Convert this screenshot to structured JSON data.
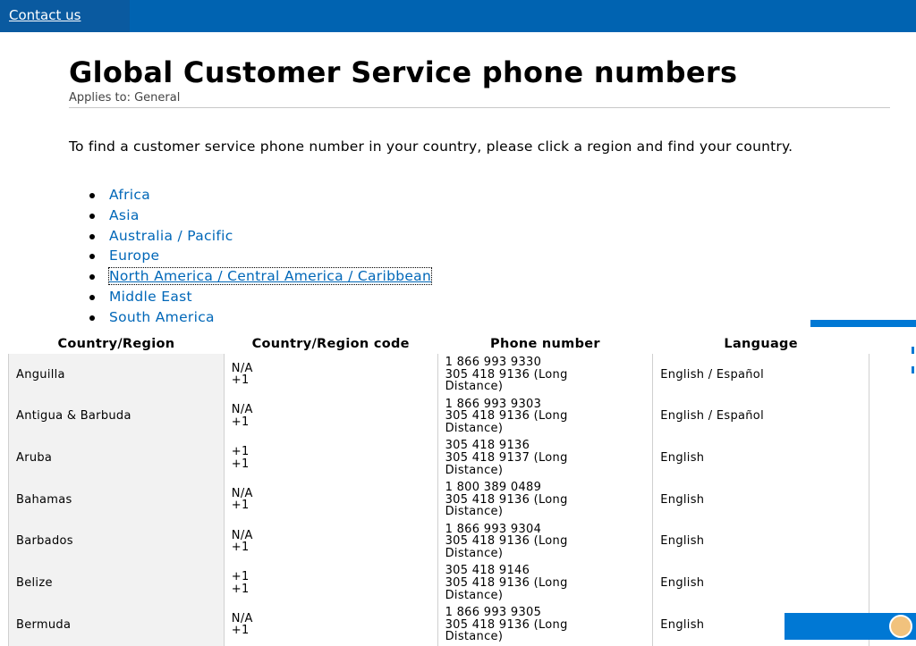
{
  "header": {
    "contact_link": "Contact us"
  },
  "page": {
    "title": "Global Customer Service phone numbers",
    "applies_to": "Applies to: General",
    "intro": "To find a customer service phone number in your country, please click a region and find your country."
  },
  "regions": [
    "Africa",
    "Asia",
    "Australia / Pacific",
    "Europe",
    "North America / Central America / Caribbean",
    "Middle East",
    "South America"
  ],
  "table": {
    "headers": [
      "Country/Region",
      "Country/Region code",
      "Phone number",
      "Language"
    ],
    "rows": [
      {
        "country": "Anguilla",
        "code": [
          "N/A",
          "+1"
        ],
        "phone": [
          "1 866 993 9330",
          "305 418 9136 (Long",
          "Distance)"
        ],
        "language": "English / Español"
      },
      {
        "country": "Antigua & Barbuda",
        "code": [
          "N/A",
          "+1"
        ],
        "phone": [
          "1 866 993 9303",
          "305 418 9136 (Long",
          "Distance)"
        ],
        "language": "English / Español"
      },
      {
        "country": "Aruba",
        "code": [
          "+1",
          "+1"
        ],
        "phone": [
          "305 418 9136",
          "305 418 9137 (Long",
          "Distance)"
        ],
        "language": "English"
      },
      {
        "country": "Bahamas",
        "code": [
          "N/A",
          "+1"
        ],
        "phone": [
          "1 800 389 0489",
          "305 418 9136 (Long",
          "Distance)"
        ],
        "language": "English"
      },
      {
        "country": "Barbados",
        "code": [
          "N/A",
          "+1"
        ],
        "phone": [
          "1 866 993 9304",
          "305 418 9136 (Long",
          "Distance)"
        ],
        "language": "English"
      },
      {
        "country": "Belize",
        "code": [
          "+1",
          "+1"
        ],
        "phone": [
          "305 418 9146",
          "305 418 9136 (Long",
          "Distance)"
        ],
        "language": "English"
      },
      {
        "country": "Bermuda",
        "code": [
          "N/A",
          "+1"
        ],
        "phone": [
          "1 866 993 9305",
          "305 418 9136 (Long",
          "Distance)"
        ],
        "language": "English"
      }
    ]
  },
  "icons": {
    "chat": "chat-agent-avatar-icon"
  },
  "colors": {
    "header_bg": "#0063b1",
    "link": "#0067b8",
    "accent": "#0078d4"
  }
}
